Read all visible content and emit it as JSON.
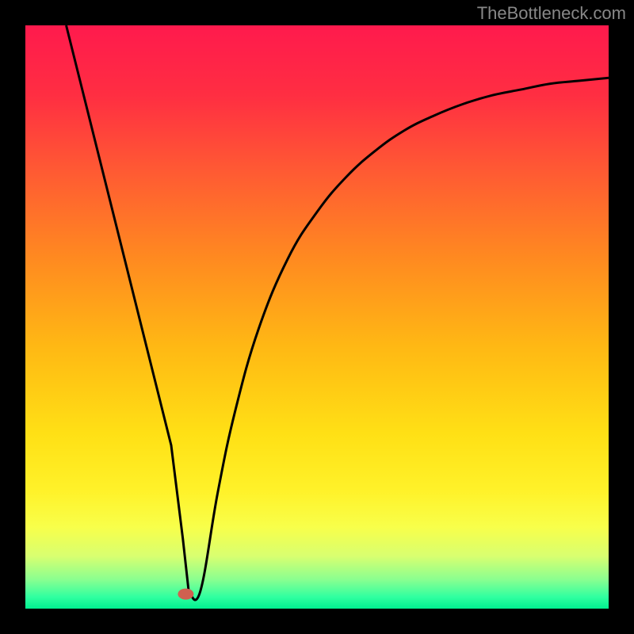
{
  "attribution": "TheBottleneck.com",
  "chart_data": {
    "type": "line",
    "title": "",
    "xlabel": "",
    "ylabel": "",
    "xlim": [
      0,
      100
    ],
    "ylim": [
      0,
      100
    ],
    "series": [
      {
        "name": "curve",
        "x": [
          7,
          10,
          15,
          20,
          23,
          25,
          27,
          28,
          30,
          33,
          36,
          40,
          45,
          50,
          55,
          60,
          65,
          70,
          75,
          80,
          85,
          90,
          95,
          100
        ],
        "y": [
          100,
          88,
          68,
          48,
          36,
          28,
          12,
          3,
          3,
          20,
          34,
          48,
          60,
          68,
          74,
          78.5,
          82,
          84.5,
          86.5,
          88,
          89,
          90,
          90.5,
          91
        ]
      }
    ],
    "marker": {
      "x": 27.5,
      "y": 2.5,
      "color": "#d06050"
    },
    "gradient_stops": [
      {
        "offset": 0,
        "color": "#ff1a4d"
      },
      {
        "offset": 12,
        "color": "#ff2e42"
      },
      {
        "offset": 25,
        "color": "#ff5a33"
      },
      {
        "offset": 40,
        "color": "#ff8a20"
      },
      {
        "offset": 55,
        "color": "#ffb814"
      },
      {
        "offset": 70,
        "color": "#ffe015"
      },
      {
        "offset": 80,
        "color": "#fff22a"
      },
      {
        "offset": 86,
        "color": "#f8ff4a"
      },
      {
        "offset": 91,
        "color": "#d8ff70"
      },
      {
        "offset": 95,
        "color": "#8aff90"
      },
      {
        "offset": 98,
        "color": "#30ffa0"
      },
      {
        "offset": 100,
        "color": "#00f090"
      }
    ]
  }
}
